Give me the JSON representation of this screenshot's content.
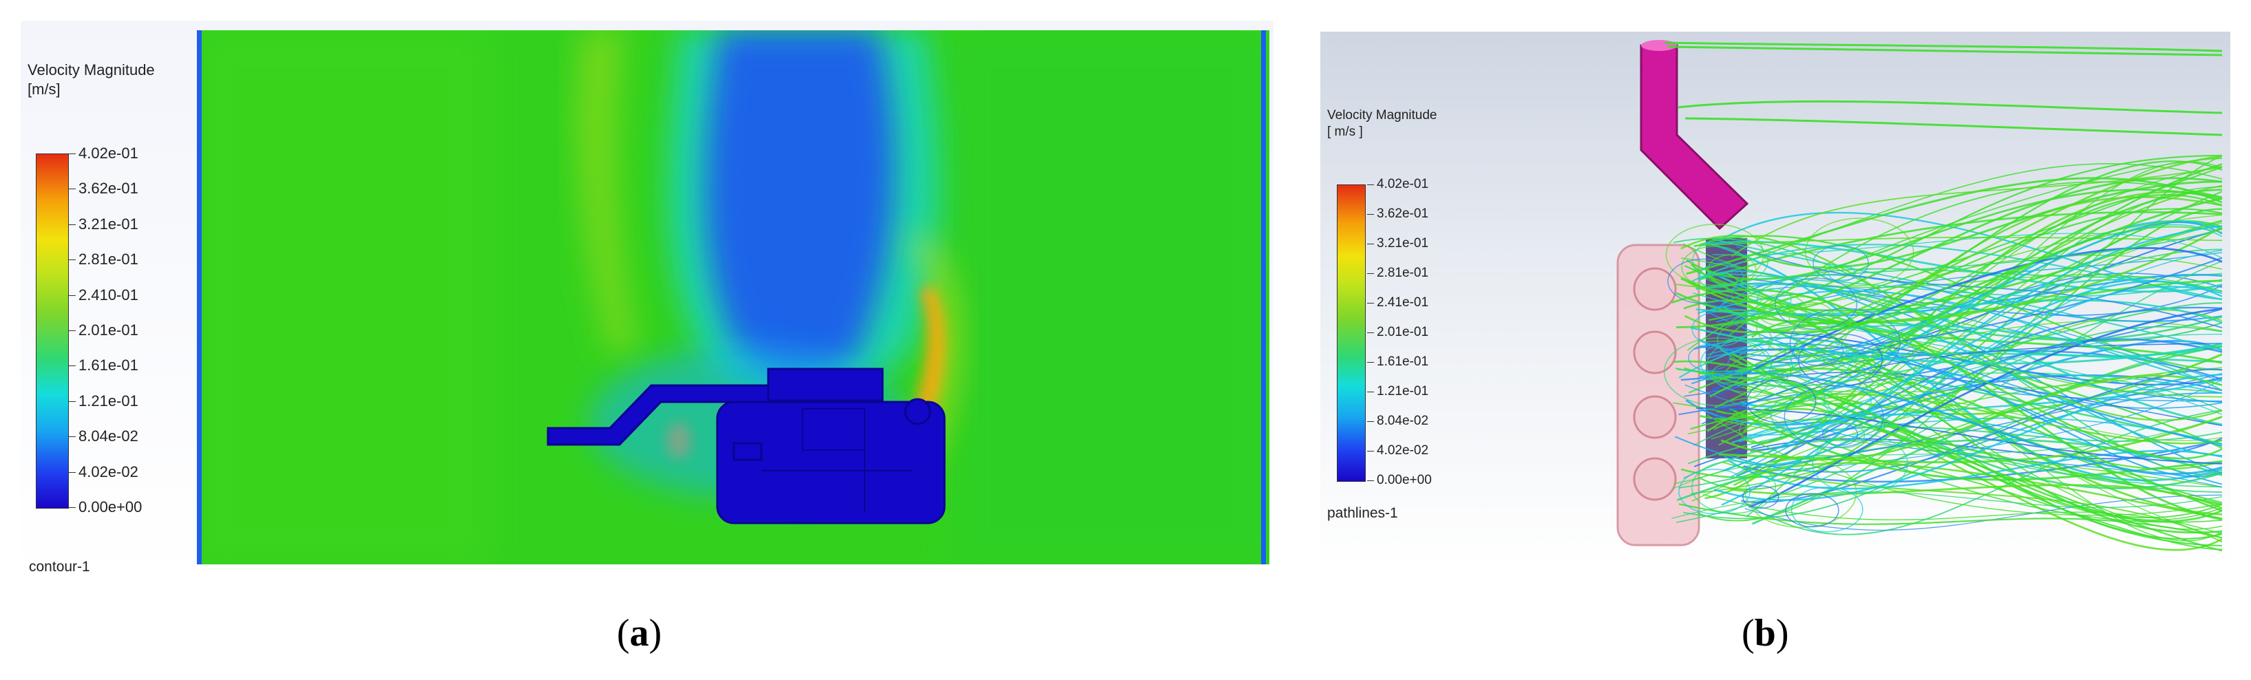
{
  "panel_a": {
    "legend_title": "Velocity Magnitude\n[m/s]",
    "ticks": [
      "4.02e-01",
      "3.62e-01",
      "3.21e-01",
      "2.81e-01",
      "2.410-01",
      "2.01e-01",
      "1.61e-01",
      "1.21e-01",
      "8.04e-02",
      "4.02e-02",
      "0.00e+00"
    ],
    "footer": "contour-1",
    "caption_open": "(",
    "caption_letter": "a",
    "caption_close": ")"
  },
  "panel_b": {
    "legend_title": "Velocity Magnitude\n[ m/s ]",
    "ticks": [
      "4.02e-01",
      "3.62e-01",
      "3.21e-01",
      "2.81e-01",
      "2.41e-01",
      "2.01e-01",
      "1.61e-01",
      "1.21e-01",
      "8.04e-02",
      "4.02e-02",
      "0.00e+00"
    ],
    "footer": "pathlines-1",
    "caption_open": "(",
    "caption_letter": "b",
    "caption_close": ")"
  },
  "colors": {
    "field_green": "#33d11e",
    "wake_blue": "#1c64e8",
    "body_blue": "#1308c8",
    "hot_orange": "#f59a0a",
    "pipe_magenta": "#d0189e"
  },
  "colormap": "rainbow blue-to-red"
}
